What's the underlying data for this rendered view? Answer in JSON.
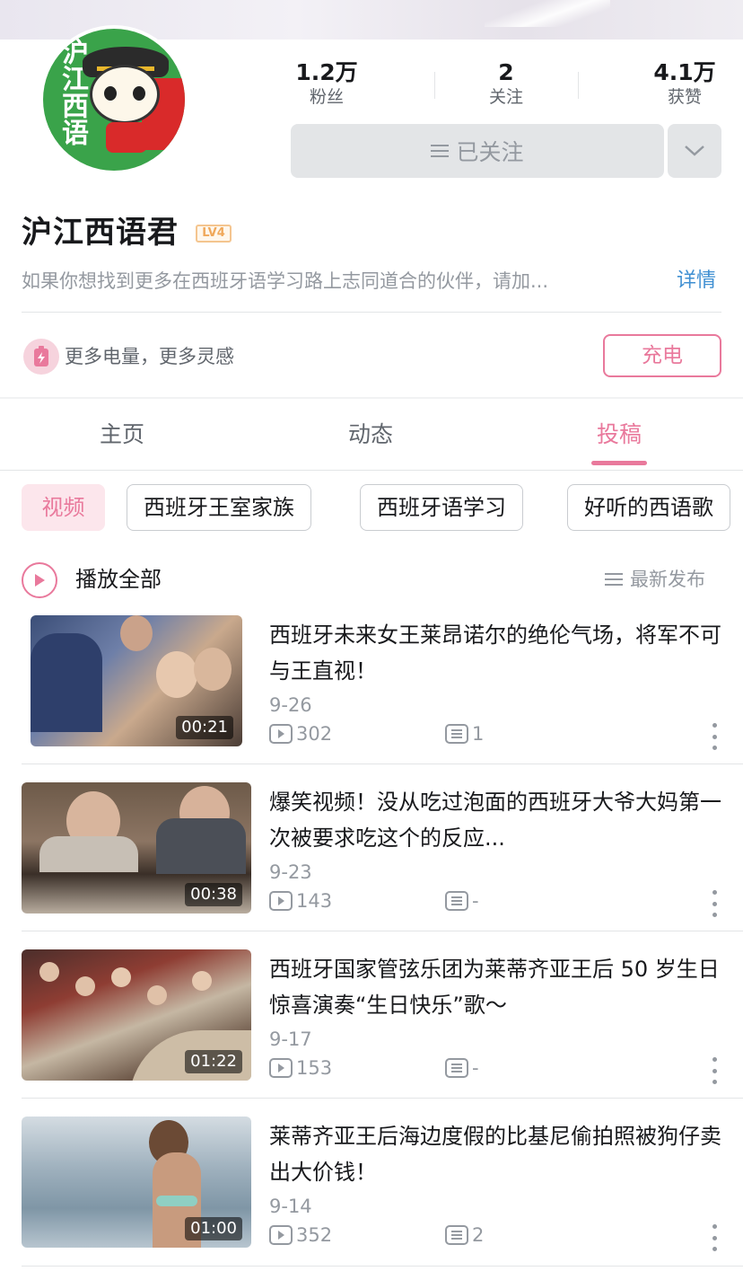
{
  "profile": {
    "name": "沪江西语君",
    "level": "LV4",
    "avatar_text": "沪江西语",
    "bio": "如果你想找到更多在西班牙语学习路上志同道合的伙伴，请加...",
    "bio_detail": "详情",
    "stats": [
      {
        "value": "1.2万",
        "label": "粉丝"
      },
      {
        "value": "2",
        "label": "关注"
      },
      {
        "value": "4.1万",
        "label": "获赞"
      }
    ],
    "follow_label": "已关注"
  },
  "charge": {
    "text": "更多电量，更多灵感",
    "button": "充电"
  },
  "tabs": [
    {
      "label": "主页",
      "active": false
    },
    {
      "label": "动态",
      "active": false
    },
    {
      "label": "投稿",
      "active": true
    }
  ],
  "chips": [
    {
      "label": "视频",
      "active": true
    },
    {
      "label": "西班牙王室家族",
      "active": false
    },
    {
      "label": "西班牙语学习",
      "active": false
    },
    {
      "label": "好听的西语歌",
      "active": false
    }
  ],
  "list_header": {
    "play_all": "播放全部",
    "sort": "最新发布"
  },
  "videos": [
    {
      "title": "西班牙未来女王莱昂诺尔的绝伦气场，将军不可与王直视！",
      "date": "9-26",
      "plays": "302",
      "comments": "1",
      "duration": "00:21"
    },
    {
      "title": "爆笑视频！没从吃过泡面的西班牙大爷大妈第一次被要求吃这个的反应...",
      "date": "9-23",
      "plays": "143",
      "comments": "-",
      "duration": "00:38"
    },
    {
      "title": "西班牙国家管弦乐团为莱蒂齐亚王后 50 岁生日惊喜演奏“生日快乐”歌～",
      "date": "9-17",
      "plays": "153",
      "comments": "-",
      "duration": "01:22"
    },
    {
      "title": "莱蒂齐亚王后海边度假的比基尼偷拍照被狗仔卖出大价钱！",
      "date": "9-14",
      "plays": "352",
      "comments": "2",
      "duration": "01:00"
    }
  ],
  "colors": {
    "accent": "#e9799c",
    "link": "#3f8fd2",
    "muted": "#9499a0"
  }
}
